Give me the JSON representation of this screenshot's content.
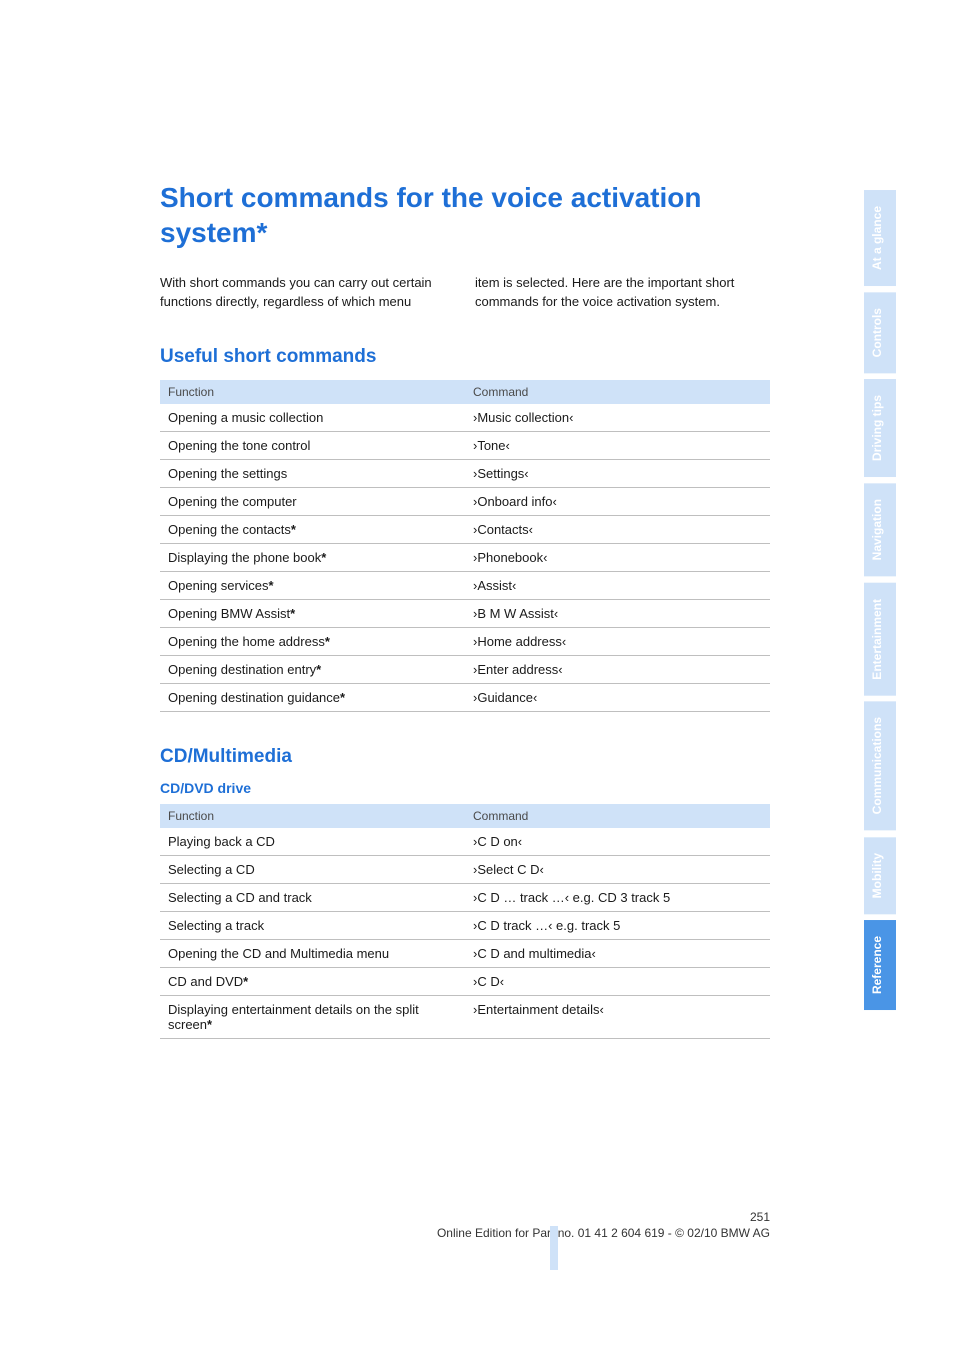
{
  "title": "Short commands for the voice activation system*",
  "intro_left": "With short commands you can carry out certain functions directly, regardless of which menu",
  "intro_right": "item is selected. Here are the important short commands for the voice activation system.",
  "sections": {
    "useful": {
      "heading": "Useful short commands",
      "cols": {
        "func": "Function",
        "cmd": "Command"
      },
      "rows": [
        {
          "func": "Opening a music collection",
          "star": "",
          "cmd": "›Music collection‹"
        },
        {
          "func": "Opening the tone control",
          "star": "",
          "cmd": "›Tone‹"
        },
        {
          "func": "Opening the settings",
          "star": "",
          "cmd": "›Settings‹"
        },
        {
          "func": "Opening the computer",
          "star": "",
          "cmd": "›Onboard info‹"
        },
        {
          "func": "Opening the contacts",
          "star": "*",
          "cmd": "›Contacts‹"
        },
        {
          "func": "Displaying the phone book",
          "star": "*",
          "cmd": "›Phonebook‹"
        },
        {
          "func": "Opening services",
          "star": "*",
          "cmd": "›Assist‹"
        },
        {
          "func": "Opening BMW Assist",
          "star": "*",
          "cmd": "›B M W Assist‹"
        },
        {
          "func": "Opening the home address",
          "star": "*",
          "cmd": "›Home address‹"
        },
        {
          "func": "Opening destination entry",
          "star": "*",
          "cmd": "›Enter address‹"
        },
        {
          "func": "Opening destination guidance",
          "star": "*",
          "cmd": "›Guidance‹"
        }
      ]
    },
    "cdmm": {
      "heading": "CD/Multimedia",
      "sub": "CD/DVD drive",
      "cols": {
        "func": "Function",
        "cmd": "Command"
      },
      "rows": [
        {
          "func": "Playing back a CD",
          "star": "",
          "cmd": "›C D on‹"
        },
        {
          "func": "Selecting a CD",
          "star": "",
          "cmd": "›Select C D‹"
        },
        {
          "func": "Selecting a CD and track",
          "star": "",
          "cmd": "›C D … track …‹ e.g. CD 3 track 5"
        },
        {
          "func": "Selecting a track",
          "star": "",
          "cmd": "›C D track …‹ e.g. track 5"
        },
        {
          "func": "Opening the CD and Multimedia menu",
          "star": "",
          "cmd": "›C D and multimedia‹"
        },
        {
          "func": "CD and DVD",
          "star": "*",
          "cmd": "›C D‹"
        },
        {
          "func": "Displaying entertainment details on the split screen",
          "star": "*",
          "cmd": "›Entertainment details‹"
        }
      ]
    }
  },
  "tabs": [
    {
      "label": "At a glance",
      "active": false
    },
    {
      "label": "Controls",
      "active": false
    },
    {
      "label": "Driving tips",
      "active": false
    },
    {
      "label": "Navigation",
      "active": false
    },
    {
      "label": "Entertainment",
      "active": false
    },
    {
      "label": "Communications",
      "active": false
    },
    {
      "label": "Mobility",
      "active": false
    },
    {
      "label": "Reference",
      "active": true
    }
  ],
  "footer": {
    "page": "251",
    "edition": "Online Edition for Part no. 01 41 2 604 619 - © 02/10 BMW AG"
  }
}
